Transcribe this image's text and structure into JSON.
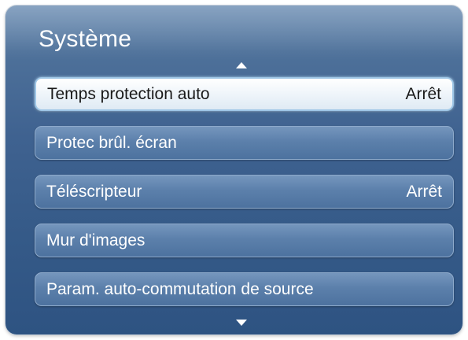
{
  "menu": {
    "title": "Système",
    "up_icon": "triangle-up",
    "down_icon": "triangle-down",
    "items": [
      {
        "label": "Temps protection auto",
        "value": "Arrêt",
        "selected": true
      },
      {
        "label": "Protec brûl. écran",
        "value": ""
      },
      {
        "label": "Téléscripteur",
        "value": "Arrêt"
      },
      {
        "label": "Mur d'images",
        "value": ""
      },
      {
        "label": "Param. auto-commutation de source",
        "value": ""
      }
    ]
  },
  "colors": {
    "panel": "#3f6290",
    "item": "#5c80ab",
    "selected_item": "#ffffff",
    "selected_border": "#9ec6e6"
  }
}
